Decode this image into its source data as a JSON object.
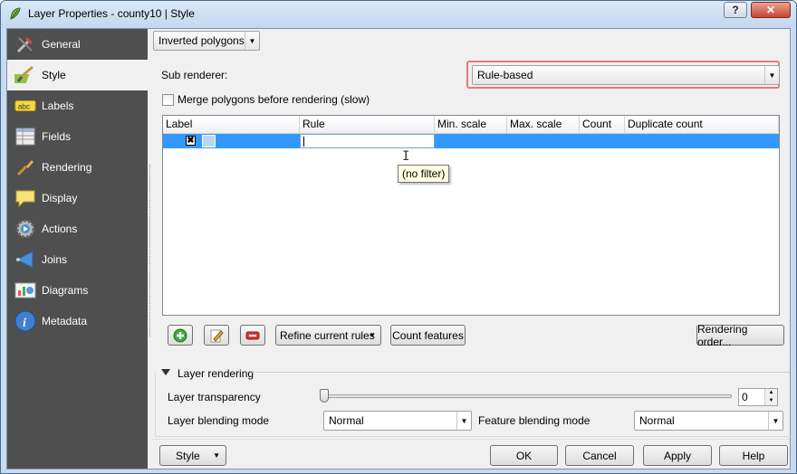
{
  "window": {
    "title": "Layer Properties - county10 | Style",
    "help_label": "?",
    "close_label": "✕"
  },
  "sidebar": {
    "items": [
      {
        "label": "General",
        "icon": "tools-icon"
      },
      {
        "label": "Style",
        "icon": "style-icon",
        "active": true
      },
      {
        "label": "Labels",
        "icon": "labels-icon"
      },
      {
        "label": "Fields",
        "icon": "fields-icon"
      },
      {
        "label": "Rendering",
        "icon": "rendering-icon"
      },
      {
        "label": "Display",
        "icon": "display-icon"
      },
      {
        "label": "Actions",
        "icon": "actions-icon"
      },
      {
        "label": "Joins",
        "icon": "joins-icon"
      },
      {
        "label": "Diagrams",
        "icon": "diagrams-icon"
      },
      {
        "label": "Metadata",
        "icon": "metadata-icon"
      }
    ]
  },
  "renderer": {
    "type_value": "Inverted polygons",
    "sub_renderer_label": "Sub renderer:",
    "sub_renderer_value": "Rule-based",
    "merge_label": "Merge polygons before rendering (slow)"
  },
  "table": {
    "columns": [
      "Label",
      "Rule",
      "Min. scale",
      "Max. scale",
      "Count",
      "Duplicate count"
    ],
    "row_checkbox": "✖",
    "tooltip": "(no filter)"
  },
  "toolbar": {
    "refine_label": "Refine current rules",
    "count_label": "Count features",
    "order_label": "Rendering order..."
  },
  "layer_rendering": {
    "title": "Layer rendering",
    "transparency_label": "Layer transparency",
    "transparency_value": "0",
    "transparency_level": 0,
    "layer_blend_label": "Layer blending mode",
    "layer_blend_value": "Normal",
    "feature_blend_label": "Feature blending mode",
    "feature_blend_value": "Normal"
  },
  "footer": {
    "style_label": "Style",
    "ok_label": "OK",
    "cancel_label": "Cancel",
    "apply_label": "Apply",
    "help_label": "Help"
  },
  "colors": {
    "sidebar_bg": "#4f4f4f",
    "selection": "#3399ff",
    "highlight_border": "#e57a7a"
  }
}
